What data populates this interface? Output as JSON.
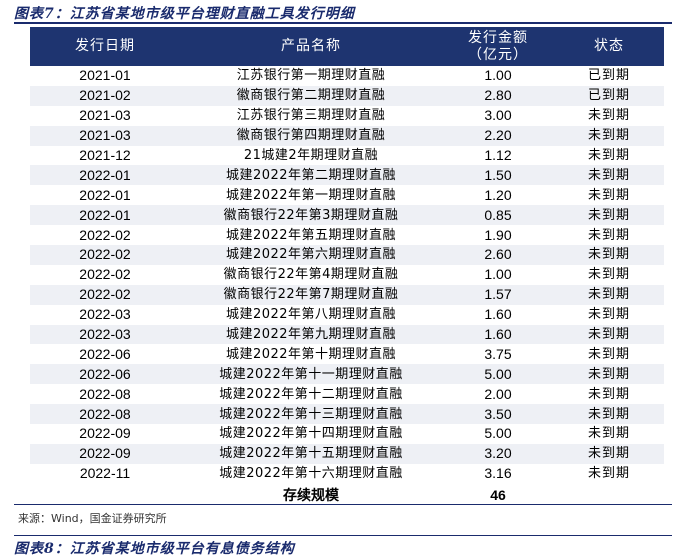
{
  "figure_title": "图表7：江苏省某地市级平台理财直融工具发行明细",
  "columns": {
    "date": "发行日期",
    "name": "产品名称",
    "amount_line1": "发行金额",
    "amount_line2": "（亿元）",
    "status": "状态"
  },
  "rows": [
    {
      "date": "2021-01",
      "name": "江苏银行第一期理财直融",
      "amount": "1.00",
      "status": "已到期"
    },
    {
      "date": "2021-02",
      "name": "徽商银行第二期理财直融",
      "amount": "2.80",
      "status": "已到期"
    },
    {
      "date": "2021-03",
      "name": "江苏银行第三期理财直融",
      "amount": "3.00",
      "status": "未到期"
    },
    {
      "date": "2021-03",
      "name": "徽商银行第四期理财直融",
      "amount": "2.20",
      "status": "未到期"
    },
    {
      "date": "2021-12",
      "name": "21城建2年期理财直融",
      "amount": "1.12",
      "status": "未到期"
    },
    {
      "date": "2022-01",
      "name": "城建2022年第二期理财直融",
      "amount": "1.50",
      "status": "未到期"
    },
    {
      "date": "2022-01",
      "name": "城建2022年第一期理财直融",
      "amount": "1.20",
      "status": "未到期"
    },
    {
      "date": "2022-01",
      "name": "徽商银行22年第3期理财直融",
      "amount": "0.85",
      "status": "未到期"
    },
    {
      "date": "2022-02",
      "name": "城建2022年第五期理财直融",
      "amount": "1.90",
      "status": "未到期"
    },
    {
      "date": "2022-02",
      "name": "城建2022年第六期理财直融",
      "amount": "2.60",
      "status": "未到期"
    },
    {
      "date": "2022-02",
      "name": "徽商银行22年第4期理财直融",
      "amount": "1.00",
      "status": "未到期"
    },
    {
      "date": "2022-02",
      "name": "徽商银行22年第7期理财直融",
      "amount": "1.57",
      "status": "未到期"
    },
    {
      "date": "2022-03",
      "name": "城建2022年第八期理财直融",
      "amount": "1.60",
      "status": "未到期"
    },
    {
      "date": "2022-03",
      "name": "城建2022年第九期理财直融",
      "amount": "1.60",
      "status": "未到期"
    },
    {
      "date": "2022-06",
      "name": "城建2022年第十期理财直融",
      "amount": "3.75",
      "status": "未到期"
    },
    {
      "date": "2022-06",
      "name": "城建2022年第十一期理财直融",
      "amount": "5.00",
      "status": "未到期"
    },
    {
      "date": "2022-08",
      "name": "城建2022年第十二期理财直融",
      "amount": "2.00",
      "status": "未到期"
    },
    {
      "date": "2022-08",
      "name": "城建2022年第十三期理财直融",
      "amount": "3.50",
      "status": "未到期"
    },
    {
      "date": "2022-09",
      "name": "城建2022年第十四期理财直融",
      "amount": "5.00",
      "status": "未到期"
    },
    {
      "date": "2022-09",
      "name": "城建2022年第十五期理财直融",
      "amount": "3.20",
      "status": "未到期"
    },
    {
      "date": "2022-11",
      "name": "城建2022年第十六期理财直融",
      "amount": "3.16",
      "status": "未到期"
    }
  ],
  "total": {
    "label": "存续规模",
    "amount": "46"
  },
  "source": "来源：Wind，国金证券研究所",
  "next_figure_title": "图表8：江苏省某地市级平台有息债务结构",
  "colors": {
    "header_bg": "#1e3470",
    "stripe": "#eef0f5",
    "title": "#1a2b6d"
  }
}
